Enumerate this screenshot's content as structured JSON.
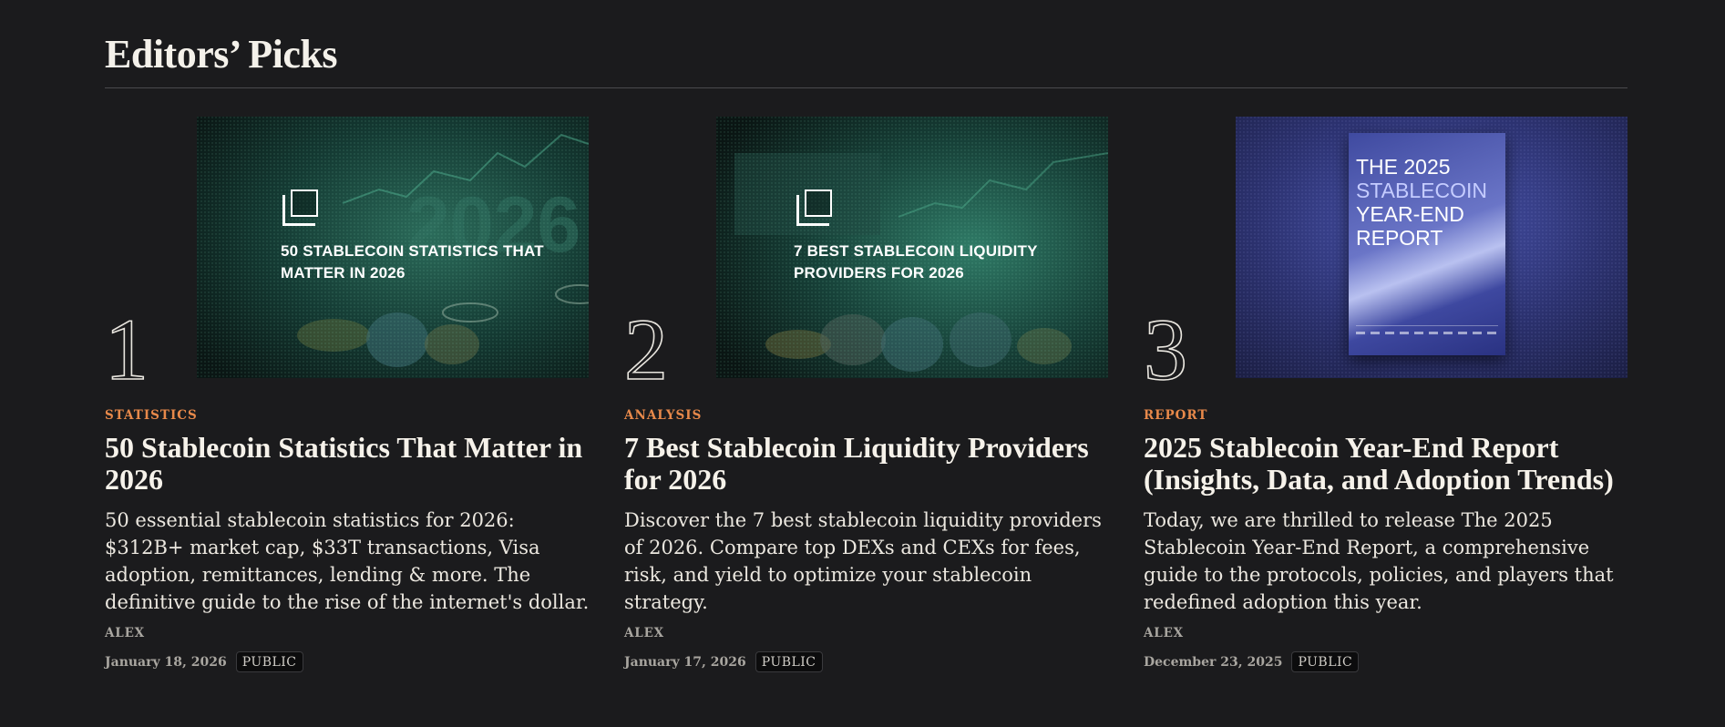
{
  "section": {
    "title": "Editors’ Picks"
  },
  "cards": [
    {
      "rank": "1",
      "category": "STATISTICS",
      "title": "50 Stablecoin Statistics That Matter in 2026",
      "excerpt": "50 essential stablecoin statistics for 2026: $312B+ market cap, $33T transactions, Visa adoption, remittances, lending & more. The definitive guide to the rise of the internet's dollar.",
      "author": "ALEX",
      "date": "January 18, 2026",
      "badge": "PUBLIC",
      "thumbnail": {
        "caption": "50 STABLECOIN STATISTICS THAT MATTER IN 2026",
        "accent": "#2b6b5a"
      }
    },
    {
      "rank": "2",
      "category": "ANALYSIS",
      "title": "7 Best Stablecoin Liquidity Providers for 2026",
      "excerpt": "Discover the 7 best stablecoin liquidity providers of 2026. Compare top DEXs and CEXs for fees, risk, and yield to optimize your stablecoin strategy.",
      "author": "ALEX",
      "date": "January 17, 2026",
      "badge": "PUBLIC",
      "thumbnail": {
        "caption": "7 BEST STABLECOIN LIQUIDITY PROVIDERS FOR 2026",
        "accent": "#2f7a66"
      }
    },
    {
      "rank": "3",
      "category": "REPORT",
      "title": "2025 Stablecoin Year-End Report (Insights, Data, and Adoption Trends)",
      "excerpt": "Today, we are thrilled to release The 2025 Stablecoin Year-End Report, a comprehensive guide to the protocols, policies, and players that redefined adoption this year.",
      "author": "ALEX",
      "date": "December 23, 2025",
      "badge": "PUBLIC",
      "thumbnail": {
        "cover_line1": "THE 2025",
        "cover_line2": "STABLECOIN",
        "cover_line3": "YEAR-END",
        "cover_line4": "REPORT",
        "accent": "#4a55b0"
      }
    }
  ],
  "colors": {
    "background": "#1b1b1d",
    "category": "#e8894a",
    "text": "#f2efe9",
    "muted": "#a9a6a0"
  }
}
